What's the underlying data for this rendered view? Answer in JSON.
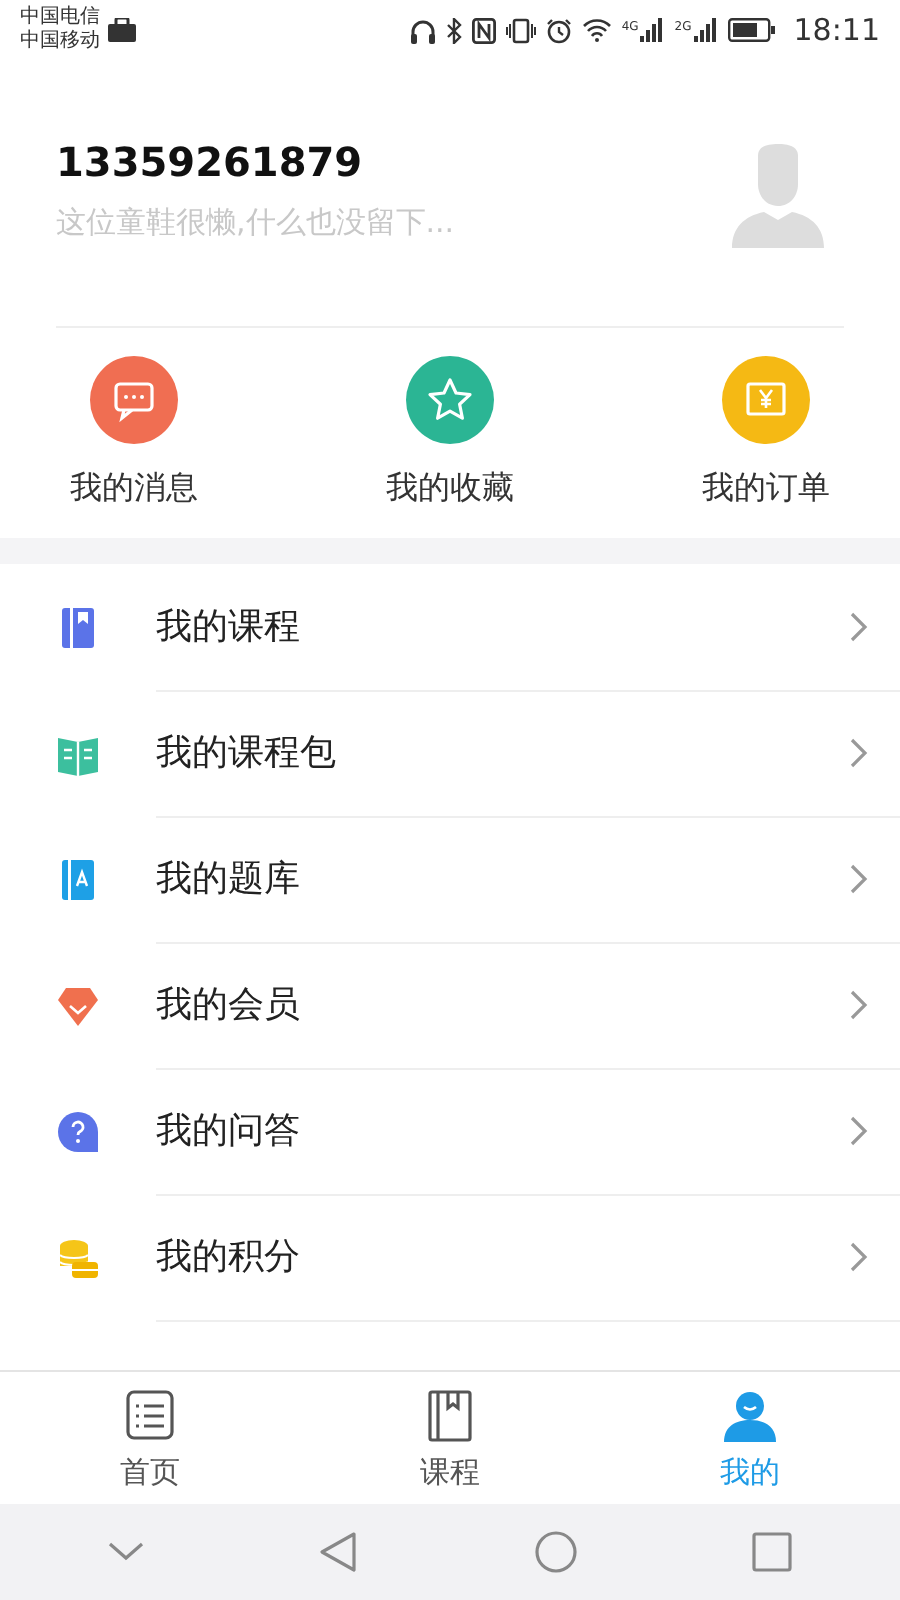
{
  "status_bar": {
    "carriers": [
      "中国电信",
      "中国移动"
    ],
    "network_labels": [
      "4G",
      "2G"
    ],
    "time": "18:11"
  },
  "profile": {
    "phone": "13359261879",
    "bio": "这位童鞋很懒,什么也没留下..."
  },
  "quick_actions": [
    {
      "label": "我的消息",
      "kind": "message",
      "color": "#f06e52"
    },
    {
      "label": "我的收藏",
      "kind": "star",
      "color": "#2bb594"
    },
    {
      "label": "我的订单",
      "kind": "order",
      "color": "#f5b914"
    }
  ],
  "menu": [
    {
      "label": "我的课程",
      "kind": "course"
    },
    {
      "label": "我的课程包",
      "kind": "package"
    },
    {
      "label": "我的题库",
      "kind": "bank"
    },
    {
      "label": "我的会员",
      "kind": "member"
    },
    {
      "label": "我的问答",
      "kind": "qa"
    },
    {
      "label": "我的积分",
      "kind": "points"
    }
  ],
  "tabs": [
    {
      "label": "首页",
      "kind": "home",
      "selected": false
    },
    {
      "label": "课程",
      "kind": "course",
      "selected": false
    },
    {
      "label": "我的",
      "kind": "me",
      "selected": true
    }
  ]
}
